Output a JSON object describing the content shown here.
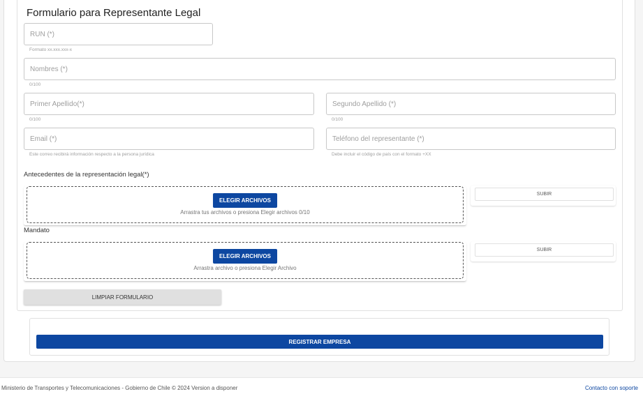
{
  "form": {
    "title": "Formulario para Representante Legal",
    "run": {
      "placeholder": "RUN (*)",
      "hint": "Formato xx.xxx.xxx-x"
    },
    "nombres": {
      "placeholder": "Nombres (*)",
      "counter": "0/100"
    },
    "primer_apellido": {
      "placeholder": "Primer Apellido(*)",
      "counter": "0/100"
    },
    "segundo_apellido": {
      "placeholder": "Segundo Apellido (*)",
      "counter": "0/100"
    },
    "email": {
      "placeholder": "Email (*)",
      "hint": "Este correo recibirá información respecto a la persona jurídica"
    },
    "telefono": {
      "placeholder": "Teléfono del representante (*)",
      "hint": "Debe incluir el código de país con el formato +XX"
    }
  },
  "uploads": {
    "antecedentes": {
      "label": "Antecedentes de la representación legal(*)",
      "choose_label": "ELEGIR ARCHIVOS",
      "drop_text": "Arrastra tus archivos o presiona Elegir archivos 0/10",
      "upload_label": "SUBIR"
    },
    "mandato": {
      "label": "Mandato",
      "choose_label": "ELEGIR ARCHIVOS",
      "drop_text": "Arrastra archivo o presiona Elegir Archivo",
      "upload_label": "SUBIR"
    }
  },
  "actions": {
    "clear_label": "LIMPIAR FORMULARIO",
    "register_label": "REGISTRAR EMPRESA"
  },
  "footer": {
    "text": "Ministerio de Transportes y Telecomunicaciones - Gobierno de Chile © 2024 Version a disponer",
    "support_link": "Contacto con soporte"
  },
  "colors": {
    "primary": "#0d47a1",
    "secondary_button": "#e0e0e0"
  }
}
